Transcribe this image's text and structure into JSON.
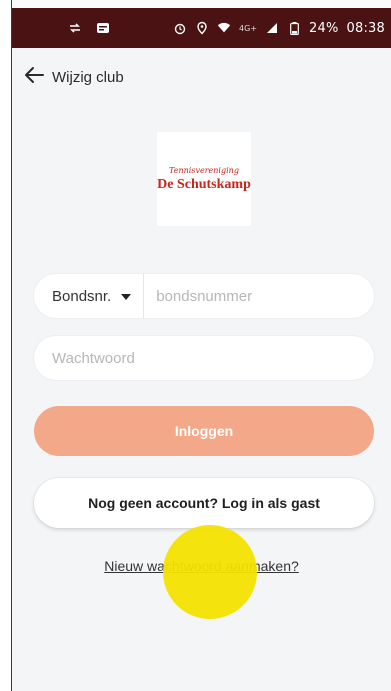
{
  "status_bar": {
    "left_icons": [
      "sync-icon",
      "message-icon"
    ],
    "right_icons": [
      "alarm-icon",
      "location-icon",
      "wifi-icon"
    ],
    "network_label": "4G+",
    "battery": "24%",
    "time": "08:38",
    "background_color": "#4a1212"
  },
  "header": {
    "back_label": "Wijzig club"
  },
  "club_logo": {
    "top_line": "Tennisvereniging",
    "name": "De Schutskamp",
    "color": "#c8251b"
  },
  "form": {
    "id_type_selected": "Bondsnr.",
    "id_placeholder": "bondsnummer",
    "password_placeholder": "Wachtwoord"
  },
  "buttons": {
    "login_label": "Inloggen",
    "login_color": "#f3a889",
    "guest_label": "Nog geen account? Log in als gast"
  },
  "links": {
    "new_password": "Nieuw wachtwoord aanmaken?"
  }
}
